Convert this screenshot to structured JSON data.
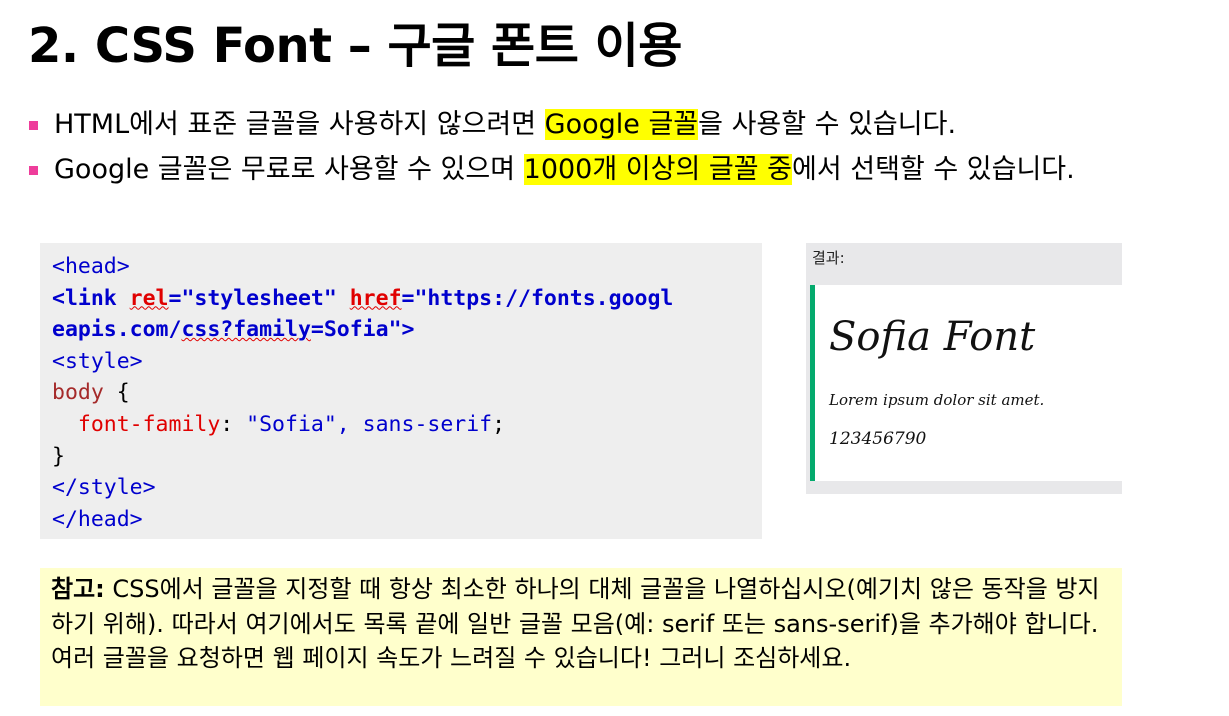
{
  "title": "2. CSS Font – 구글 폰트 이용",
  "bullets": [
    {
      "before": "HTML에서 표준 글꼴을 사용하지 않으려면 ",
      "highlight": "Google 글꼴",
      "after": "을 사용할 수 있습니다."
    },
    {
      "before": "Google 글꼴은 무료로 사용할 수 있으며 ",
      "highlight": "1000개 이상의 글꼴 중",
      "after": "에서 선택할 수 있습니다."
    }
  ],
  "code": {
    "head_open": "<head>",
    "link_open": "<link ",
    "rel_attr": "rel",
    "rel_value": "=\"stylesheet\" ",
    "href_attr": "href",
    "href_value_1": "=\"https://fonts.googl",
    "href_value_2a": "eapis.com/",
    "href_value_2b": "css?family",
    "href_value_2c": "=Sofia\">",
    "style_open": "<style>",
    "selector": "body",
    "brace_open": " {",
    "property": "font-family",
    "colon": ": ",
    "prop_value": "\"Sofia\", sans-serif",
    "semicolon": ";",
    "brace_close": "}",
    "style_close": "</style>",
    "head_close": "</head>"
  },
  "result": {
    "label": "결과:",
    "heading": "Sofia Font",
    "paragraph": "Lorem ipsum dolor sit amet.",
    "number": "123456790"
  },
  "note": {
    "bold": "참고:",
    "text1": " CSS에서 글꼴을 지정할 때 항상 최소한 하나의 대체 글꼴을 나열하십시오(예기치 않은 동작을 방지하기 위해). 따라서 여기에서도 목록 끝에 일반 글꼴 모음(예: serif 또는 sans-serif)을 추가해야 합니다.",
    "text2": "여러 글꼴을 요청하면 웹 페이지 속도가 느려질 수 있습니다! 그러니 조심하세요."
  },
  "colors": {
    "bullet": "#ee3d9b",
    "highlight": "#ffff00",
    "code_bg": "#eeeeee",
    "result_accent": "#04aa6d",
    "note_bg": "#ffffcc"
  }
}
